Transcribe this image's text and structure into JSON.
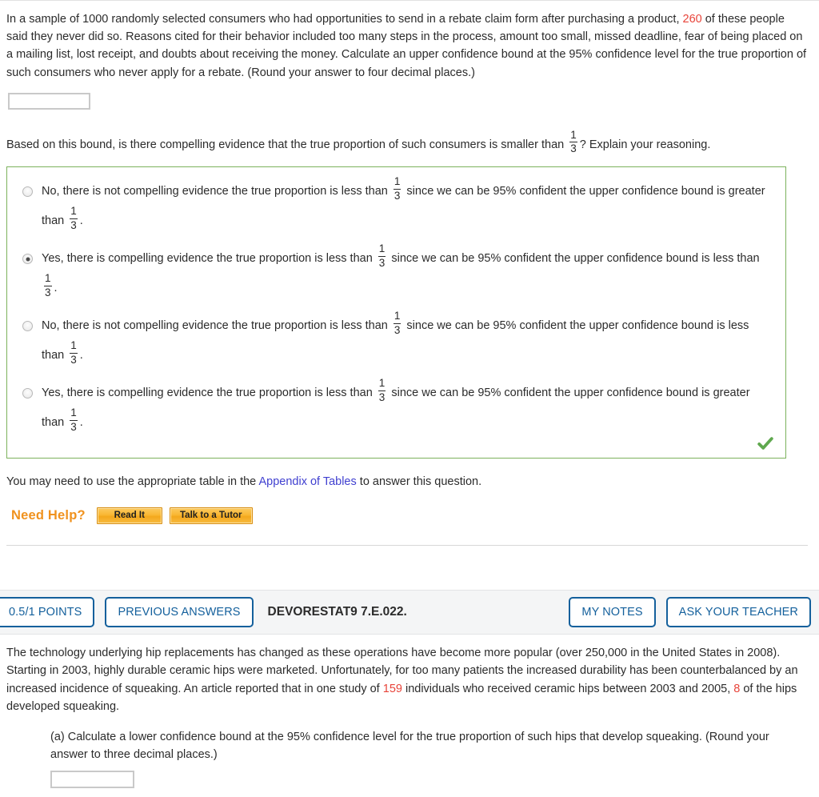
{
  "question1": {
    "prompt_part1": "In a sample of 1000 randomly selected consumers who had opportunities to send in a rebate claim form after purchasing a product, ",
    "highlight_value": "260",
    "prompt_part2": " of these people said they never did so. Reasons cited for their behavior included too many steps in the process, amount too small, missed deadline, fear of being placed on a mailing list, lost receipt, and doubts about receiving the money. Calculate an upper confidence bound at the 95% confidence level for the true proportion of such consumers who never apply for a rebate. (Round your answer to four decimal places.)",
    "answer_value": "",
    "answer_placeholder": "",
    "sub_question_part1": "Based on this bound, is there compelling evidence that the true proportion of such consumers is smaller than ",
    "sub_question_fraction": {
      "numerator": "1",
      "denominator": "3"
    },
    "sub_question_part2": "? Explain your reasoning.",
    "choices": [
      {
        "id": "choice-1",
        "selected": false,
        "seg1": "No, there is not compelling evidence the true proportion is less than ",
        "frac1": {
          "numerator": "1",
          "denominator": "3"
        },
        "seg2": " since we can be 95% confident the upper confidence bound is greater than ",
        "frac2": {
          "numerator": "1",
          "denominator": "3"
        },
        "seg3": "."
      },
      {
        "id": "choice-2",
        "selected": true,
        "seg1": "Yes, there is compelling evidence the true proportion is less than ",
        "frac1": {
          "numerator": "1",
          "denominator": "3"
        },
        "seg2": " since we can be 95% confident the upper confidence bound is less than ",
        "frac2": {
          "numerator": "1",
          "denominator": "3"
        },
        "seg3": "."
      },
      {
        "id": "choice-3",
        "selected": false,
        "seg1": "No, there is not compelling evidence the true proportion is less than ",
        "frac1": {
          "numerator": "1",
          "denominator": "3"
        },
        "seg2": " since we can be 95% confident the upper confidence bound is less than ",
        "frac2": {
          "numerator": "1",
          "denominator": "3"
        },
        "seg3": "."
      },
      {
        "id": "choice-4",
        "selected": false,
        "seg1": "Yes, there is compelling evidence the true proportion is less than ",
        "frac1": {
          "numerator": "1",
          "denominator": "3"
        },
        "seg2": " since we can be 95% confident the upper confidence bound is greater than ",
        "frac2": {
          "numerator": "1",
          "denominator": "3"
        },
        "seg3": "."
      }
    ],
    "correct_icon": "checkmark-icon",
    "table_note_part1": "You may need to use the appropriate table in the ",
    "table_note_link": "Appendix of Tables",
    "table_note_part2": " to answer this question.",
    "need_help_label": "Need Help?",
    "read_it_label": "Read It",
    "talk_to_tutor_label": "Talk to a Tutor"
  },
  "toolbar": {
    "points_label": "0.5/1 POINTS",
    "previous_answers_label": "PREVIOUS ANSWERS",
    "exercise_id": "DEVORESTAT9 7.E.022.",
    "my_notes_label": "MY NOTES",
    "ask_your_teacher_label": "ASK YOUR TEACHER"
  },
  "question2": {
    "prompt_part1": "The technology underlying hip replacements has changed as these operations have become more popular (over 250,000 in the United States in 2008). Starting in 2003, highly durable ceramic hips were marketed. Unfortunately, for too many patients the increased durability has been counterbalanced by an increased incidence of squeaking. An article reported that in one study of ",
    "highlight_value1": "159",
    "prompt_part2": " individuals who received ceramic hips between 2003 and 2005, ",
    "highlight_value2": "8",
    "prompt_part3": " of the hips developed squeaking.",
    "part_a_label": "(a) Calculate a lower confidence bound at the 95% confidence level for the true proportion of such hips that develop squeaking. (Round your answer to three decimal places.)",
    "part_a_value": "",
    "part_a_placeholder": ""
  },
  "colors": {
    "highlight_red": "#e8443a",
    "link_blue": "#4040d0",
    "correct_green": "#7cb25c",
    "toolbar_blue": "#14609c",
    "need_help_orange": "#f0921e"
  }
}
